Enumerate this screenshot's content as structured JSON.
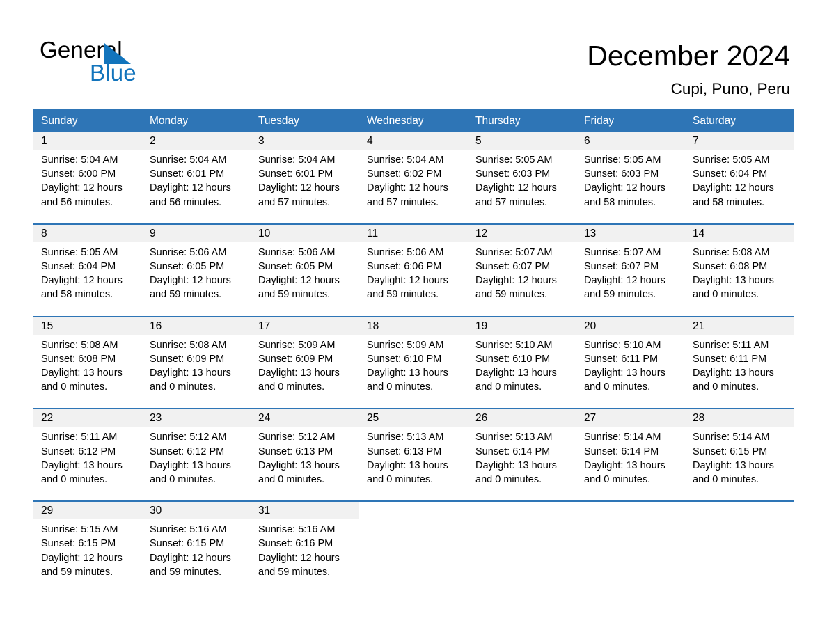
{
  "brand": {
    "name_top": "General",
    "name_bottom": "Blue",
    "color_black": "#000000",
    "color_blue": "#1274BC"
  },
  "header": {
    "title": "December 2024",
    "subtitle": "Cupi, Puno, Peru"
  },
  "theme": {
    "header_blue": "#2E75B6",
    "daynum_band": "#F1F1F1",
    "text": "#000000",
    "header_text": "#FFFFFF"
  },
  "calendar": {
    "weekday_headers": [
      "Sunday",
      "Monday",
      "Tuesday",
      "Wednesday",
      "Thursday",
      "Friday",
      "Saturday"
    ],
    "weeks": [
      [
        {
          "day": "1",
          "sunrise": "Sunrise: 5:04 AM",
          "sunset": "Sunset: 6:00 PM",
          "daylight1": "Daylight: 12 hours",
          "daylight2": "and 56 minutes."
        },
        {
          "day": "2",
          "sunrise": "Sunrise: 5:04 AM",
          "sunset": "Sunset: 6:01 PM",
          "daylight1": "Daylight: 12 hours",
          "daylight2": "and 56 minutes."
        },
        {
          "day": "3",
          "sunrise": "Sunrise: 5:04 AM",
          "sunset": "Sunset: 6:01 PM",
          "daylight1": "Daylight: 12 hours",
          "daylight2": "and 57 minutes."
        },
        {
          "day": "4",
          "sunrise": "Sunrise: 5:04 AM",
          "sunset": "Sunset: 6:02 PM",
          "daylight1": "Daylight: 12 hours",
          "daylight2": "and 57 minutes."
        },
        {
          "day": "5",
          "sunrise": "Sunrise: 5:05 AM",
          "sunset": "Sunset: 6:03 PM",
          "daylight1": "Daylight: 12 hours",
          "daylight2": "and 57 minutes."
        },
        {
          "day": "6",
          "sunrise": "Sunrise: 5:05 AM",
          "sunset": "Sunset: 6:03 PM",
          "daylight1": "Daylight: 12 hours",
          "daylight2": "and 58 minutes."
        },
        {
          "day": "7",
          "sunrise": "Sunrise: 5:05 AM",
          "sunset": "Sunset: 6:04 PM",
          "daylight1": "Daylight: 12 hours",
          "daylight2": "and 58 minutes."
        }
      ],
      [
        {
          "day": "8",
          "sunrise": "Sunrise: 5:05 AM",
          "sunset": "Sunset: 6:04 PM",
          "daylight1": "Daylight: 12 hours",
          "daylight2": "and 58 minutes."
        },
        {
          "day": "9",
          "sunrise": "Sunrise: 5:06 AM",
          "sunset": "Sunset: 6:05 PM",
          "daylight1": "Daylight: 12 hours",
          "daylight2": "and 59 minutes."
        },
        {
          "day": "10",
          "sunrise": "Sunrise: 5:06 AM",
          "sunset": "Sunset: 6:05 PM",
          "daylight1": "Daylight: 12 hours",
          "daylight2": "and 59 minutes."
        },
        {
          "day": "11",
          "sunrise": "Sunrise: 5:06 AM",
          "sunset": "Sunset: 6:06 PM",
          "daylight1": "Daylight: 12 hours",
          "daylight2": "and 59 minutes."
        },
        {
          "day": "12",
          "sunrise": "Sunrise: 5:07 AM",
          "sunset": "Sunset: 6:07 PM",
          "daylight1": "Daylight: 12 hours",
          "daylight2": "and 59 minutes."
        },
        {
          "day": "13",
          "sunrise": "Sunrise: 5:07 AM",
          "sunset": "Sunset: 6:07 PM",
          "daylight1": "Daylight: 12 hours",
          "daylight2": "and 59 minutes."
        },
        {
          "day": "14",
          "sunrise": "Sunrise: 5:08 AM",
          "sunset": "Sunset: 6:08 PM",
          "daylight1": "Daylight: 13 hours",
          "daylight2": "and 0 minutes."
        }
      ],
      [
        {
          "day": "15",
          "sunrise": "Sunrise: 5:08 AM",
          "sunset": "Sunset: 6:08 PM",
          "daylight1": "Daylight: 13 hours",
          "daylight2": "and 0 minutes."
        },
        {
          "day": "16",
          "sunrise": "Sunrise: 5:08 AM",
          "sunset": "Sunset: 6:09 PM",
          "daylight1": "Daylight: 13 hours",
          "daylight2": "and 0 minutes."
        },
        {
          "day": "17",
          "sunrise": "Sunrise: 5:09 AM",
          "sunset": "Sunset: 6:09 PM",
          "daylight1": "Daylight: 13 hours",
          "daylight2": "and 0 minutes."
        },
        {
          "day": "18",
          "sunrise": "Sunrise: 5:09 AM",
          "sunset": "Sunset: 6:10 PM",
          "daylight1": "Daylight: 13 hours",
          "daylight2": "and 0 minutes."
        },
        {
          "day": "19",
          "sunrise": "Sunrise: 5:10 AM",
          "sunset": "Sunset: 6:10 PM",
          "daylight1": "Daylight: 13 hours",
          "daylight2": "and 0 minutes."
        },
        {
          "day": "20",
          "sunrise": "Sunrise: 5:10 AM",
          "sunset": "Sunset: 6:11 PM",
          "daylight1": "Daylight: 13 hours",
          "daylight2": "and 0 minutes."
        },
        {
          "day": "21",
          "sunrise": "Sunrise: 5:11 AM",
          "sunset": "Sunset: 6:11 PM",
          "daylight1": "Daylight: 13 hours",
          "daylight2": "and 0 minutes."
        }
      ],
      [
        {
          "day": "22",
          "sunrise": "Sunrise: 5:11 AM",
          "sunset": "Sunset: 6:12 PM",
          "daylight1": "Daylight: 13 hours",
          "daylight2": "and 0 minutes."
        },
        {
          "day": "23",
          "sunrise": "Sunrise: 5:12 AM",
          "sunset": "Sunset: 6:12 PM",
          "daylight1": "Daylight: 13 hours",
          "daylight2": "and 0 minutes."
        },
        {
          "day": "24",
          "sunrise": "Sunrise: 5:12 AM",
          "sunset": "Sunset: 6:13 PM",
          "daylight1": "Daylight: 13 hours",
          "daylight2": "and 0 minutes."
        },
        {
          "day": "25",
          "sunrise": "Sunrise: 5:13 AM",
          "sunset": "Sunset: 6:13 PM",
          "daylight1": "Daylight: 13 hours",
          "daylight2": "and 0 minutes."
        },
        {
          "day": "26",
          "sunrise": "Sunrise: 5:13 AM",
          "sunset": "Sunset: 6:14 PM",
          "daylight1": "Daylight: 13 hours",
          "daylight2": "and 0 minutes."
        },
        {
          "day": "27",
          "sunrise": "Sunrise: 5:14 AM",
          "sunset": "Sunset: 6:14 PM",
          "daylight1": "Daylight: 13 hours",
          "daylight2": "and 0 minutes."
        },
        {
          "day": "28",
          "sunrise": "Sunrise: 5:14 AM",
          "sunset": "Sunset: 6:15 PM",
          "daylight1": "Daylight: 13 hours",
          "daylight2": "and 0 minutes."
        }
      ],
      [
        {
          "day": "29",
          "sunrise": "Sunrise: 5:15 AM",
          "sunset": "Sunset: 6:15 PM",
          "daylight1": "Daylight: 12 hours",
          "daylight2": "and 59 minutes."
        },
        {
          "day": "30",
          "sunrise": "Sunrise: 5:16 AM",
          "sunset": "Sunset: 6:15 PM",
          "daylight1": "Daylight: 12 hours",
          "daylight2": "and 59 minutes."
        },
        {
          "day": "31",
          "sunrise": "Sunrise: 5:16 AM",
          "sunset": "Sunset: 6:16 PM",
          "daylight1": "Daylight: 12 hours",
          "daylight2": "and 59 minutes."
        },
        {
          "day": "",
          "sunrise": "",
          "sunset": "",
          "daylight1": "",
          "daylight2": ""
        },
        {
          "day": "",
          "sunrise": "",
          "sunset": "",
          "daylight1": "",
          "daylight2": ""
        },
        {
          "day": "",
          "sunrise": "",
          "sunset": "",
          "daylight1": "",
          "daylight2": ""
        },
        {
          "day": "",
          "sunrise": "",
          "sunset": "",
          "daylight1": "",
          "daylight2": ""
        }
      ]
    ]
  }
}
